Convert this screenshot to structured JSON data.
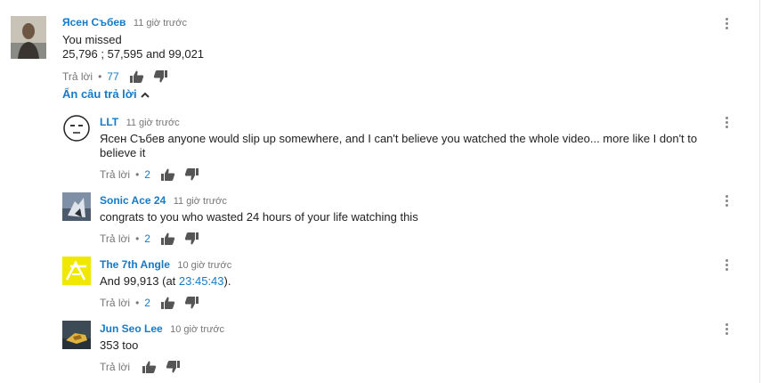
{
  "top_comment": {
    "author": "Ясен Събев",
    "time": "11 giờ trước",
    "text_lines": [
      "You missed",
      "25,796 ;  57,595 and 99,021"
    ],
    "reply_label": "Trả lời",
    "like_count": "77"
  },
  "replies_toggle": {
    "label": "Ẩn câu trả lời"
  },
  "replies": [
    {
      "author": "LLT",
      "time": "11 giờ trước",
      "text_lines": [
        "Ясен Събев anyone would slip up somewhere, and I can't believe you watched the whole video... more like I don't to",
        "believe it"
      ],
      "reply_label": "Trả lời",
      "like_count": "2"
    },
    {
      "author": "Sonic Ace 24",
      "time": "11 giờ trước",
      "text_lines": [
        "congrats to you who wasted 24 hours of your life watching this"
      ],
      "reply_label": "Trả lời",
      "like_count": "2"
    },
    {
      "author": "The 7th Angle",
      "time": "10 giờ trước",
      "text_prefix": "And 99,913 (at ",
      "text_link": "23:45:43",
      "text_suffix": ").",
      "reply_label": "Trả lời",
      "like_count": "2"
    },
    {
      "author": "Jun Seo Lee",
      "time": "10 giờ trước",
      "text_lines": [
        "353 too"
      ],
      "reply_label": "Trả lời"
    }
  ],
  "colors": {
    "link": "#167ac6",
    "meta": "#767676",
    "text": "#222222",
    "thumb_icon": "#555555",
    "seventh_angle_avatar": "#f0e800"
  },
  "icons": [
    "more-vert-icon",
    "thumb-up-icon",
    "thumb-down-icon",
    "chevron-up-icon"
  ]
}
